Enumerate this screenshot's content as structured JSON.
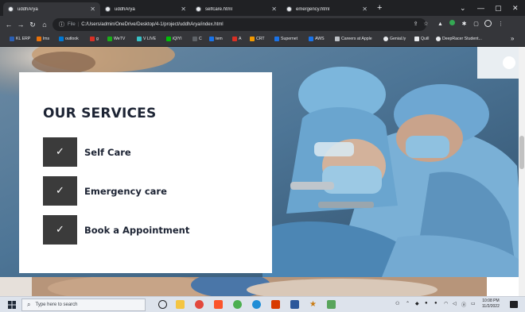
{
  "browser": {
    "tabs": [
      {
        "title": "uddhArya",
        "active": true
      },
      {
        "title": "uddhArya",
        "active": false
      },
      {
        "title": "selfcare.html",
        "active": false
      },
      {
        "title": "emergency.html",
        "active": false
      }
    ],
    "new_tab": "+",
    "address": {
      "scheme": "File",
      "url": "C:/Users/admin/OneDrive/Desktop/4-1/project/uddhArya/index.html"
    },
    "bookmarks": [
      {
        "label": "KL ERP",
        "color": "#2b5fb3"
      },
      {
        "label": "lms",
        "color": "#e8710a"
      },
      {
        "label": "outlook",
        "color": "#0078d4"
      },
      {
        "label": "g",
        "color": "#d93025"
      },
      {
        "label": "WeTV",
        "color": "#1aad19"
      },
      {
        "label": "V LIVE",
        "color": "#37c1c6"
      },
      {
        "label": "iQIYI",
        "color": "#00be06"
      },
      {
        "label": "C",
        "color": "#5f6368"
      },
      {
        "label": "tem",
        "color": "#1a73e8"
      },
      {
        "label": "A",
        "color": "#d93025"
      },
      {
        "label": "CRT",
        "color": "#f29900"
      },
      {
        "label": "Supernet",
        "color": "#1a73e8"
      },
      {
        "label": "AWS",
        "color": "#1a73e8"
      },
      {
        "label": "Careers at Apple",
        "color": "#bdc1c6"
      },
      {
        "label": "Genial.ly",
        "color": "#e8eaed"
      },
      {
        "label": "Quill",
        "color": "#e8eaed"
      },
      {
        "label": "DeepRacer Student...",
        "color": "#e8eaed"
      }
    ],
    "bookmarks_more": "»"
  },
  "page": {
    "services_title": "OUR SERVICES",
    "services": [
      {
        "label": "Self Care"
      },
      {
        "label": "Emergency care"
      },
      {
        "label": "Book a Appointment"
      }
    ],
    "check_glyph": "✓",
    "colors": {
      "heading": "#1d2434",
      "check_bg": "#3b3b3b",
      "card": "#ffffff"
    }
  },
  "taskbar": {
    "search_placeholder": "Type here to search",
    "time": "10:08 PM",
    "date": "11/2/2022"
  }
}
